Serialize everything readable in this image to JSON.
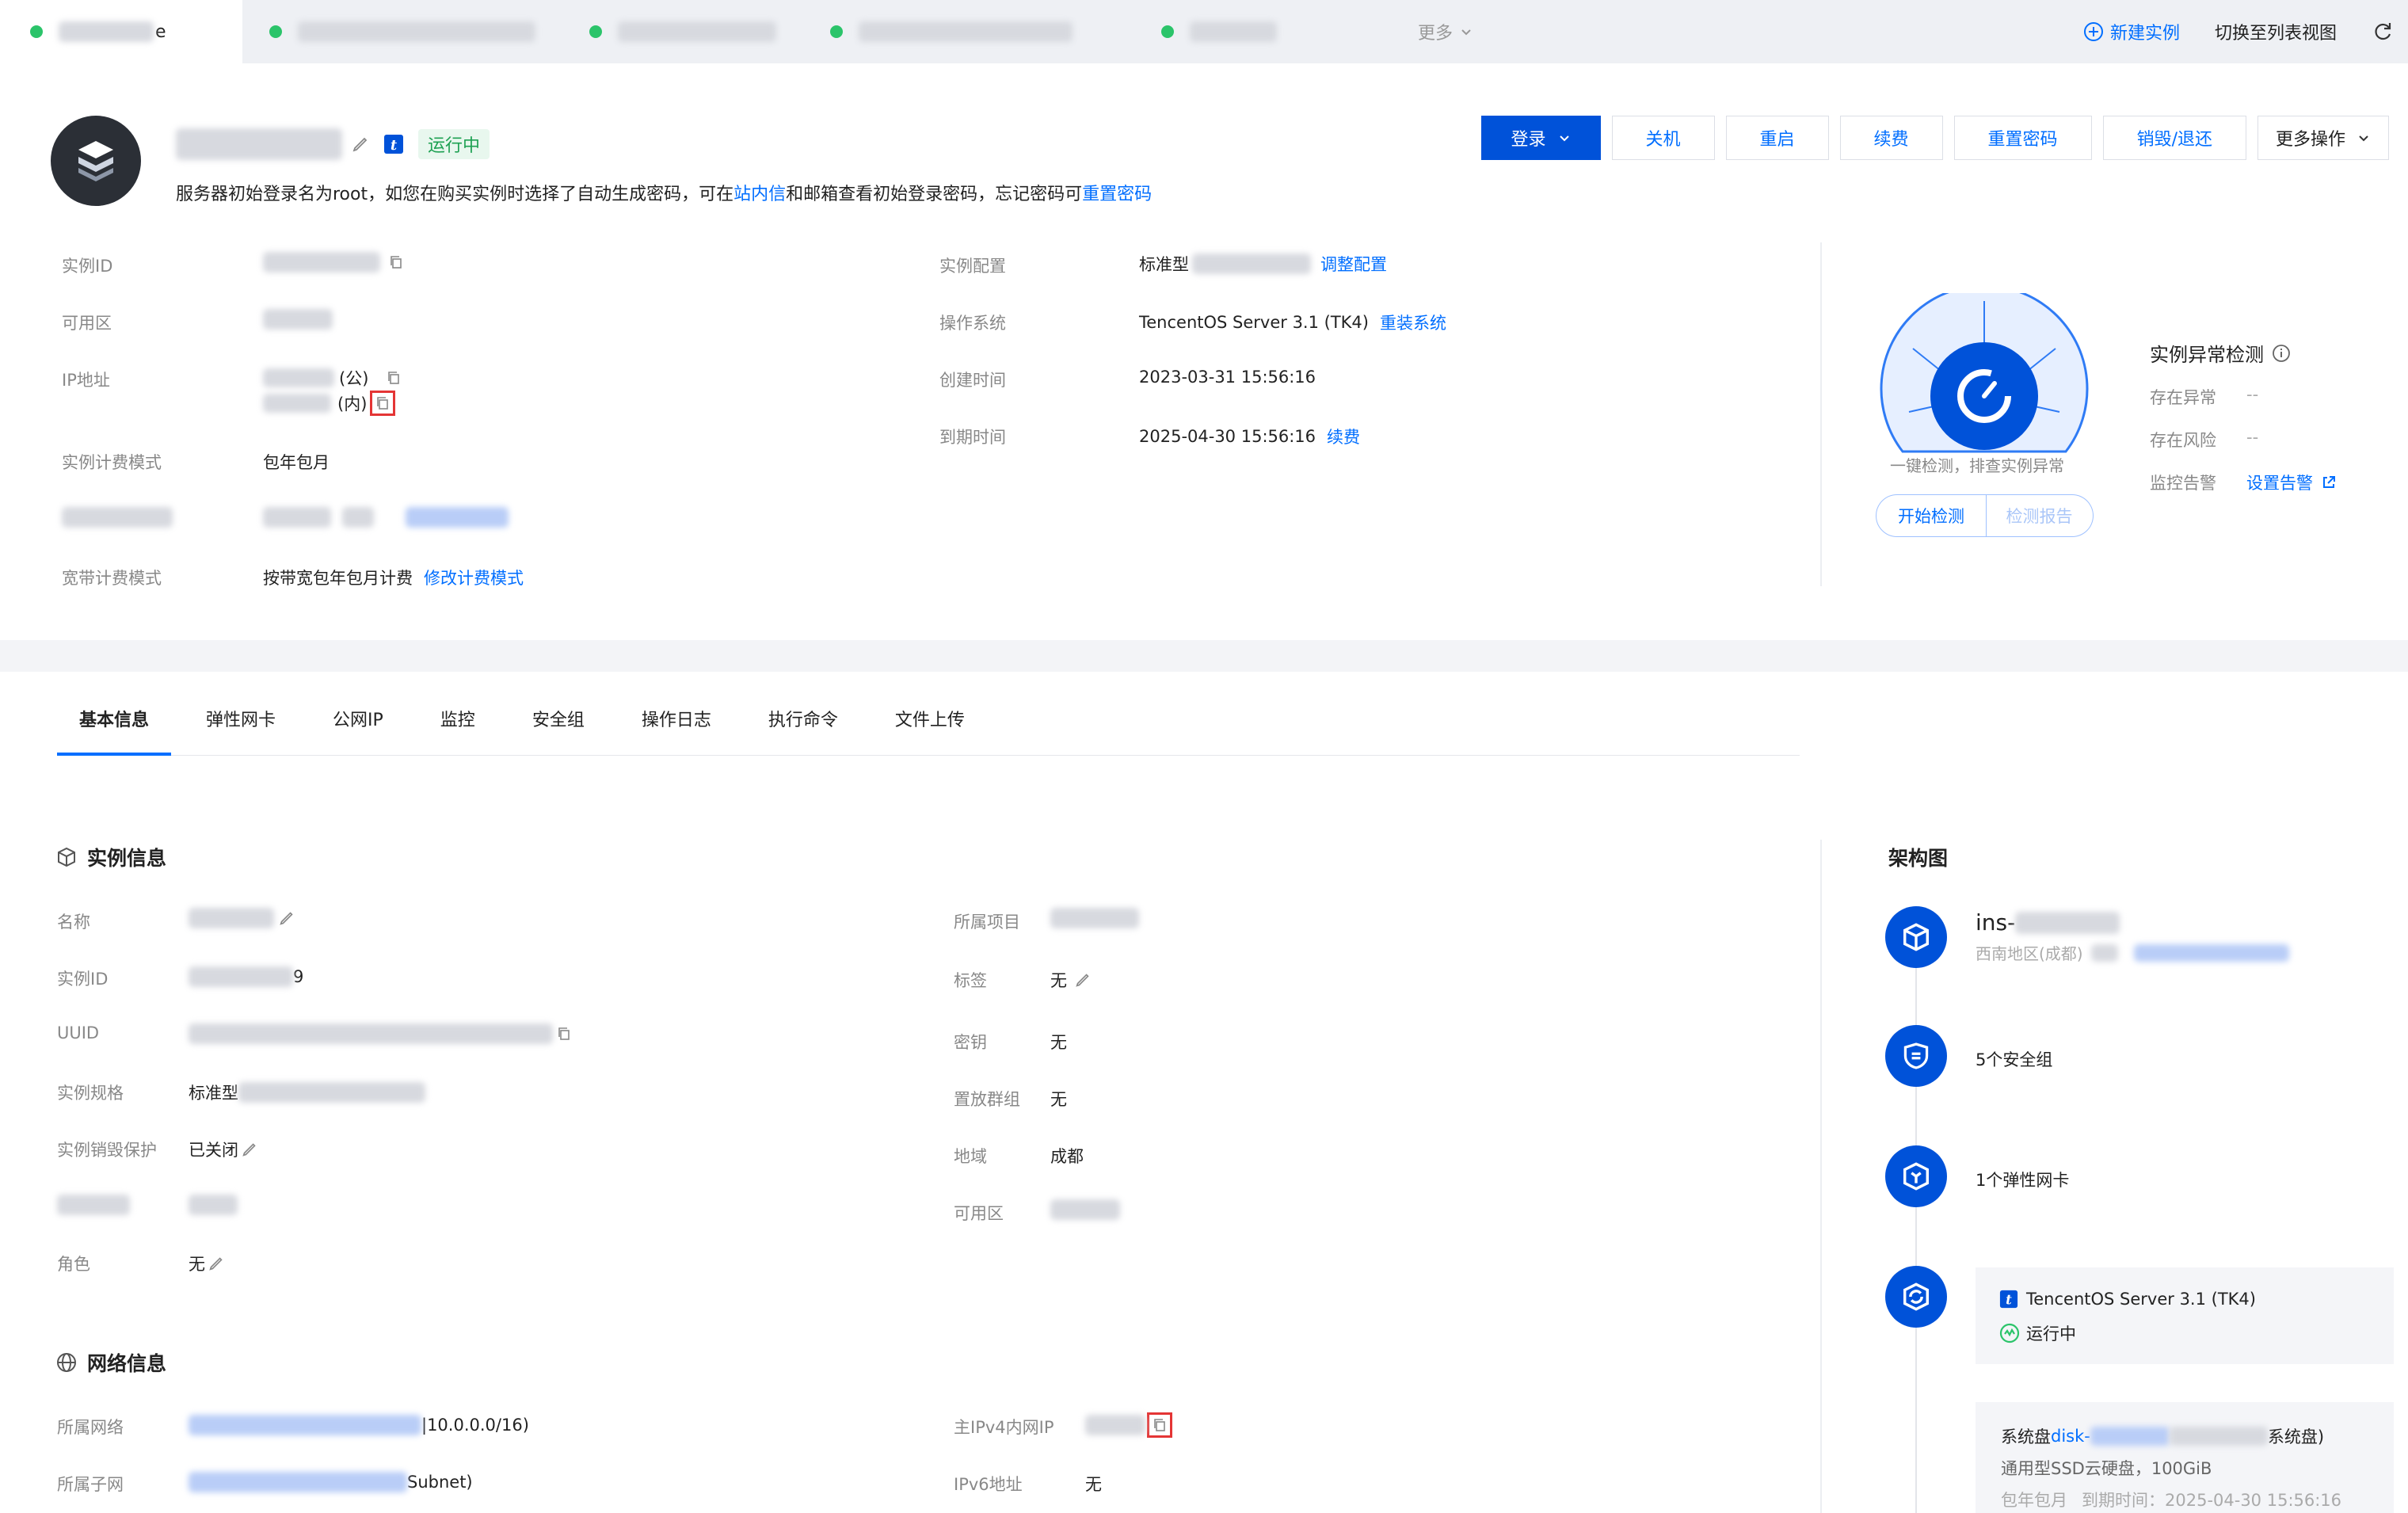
{
  "tabs": [
    {
      "label": "e",
      "active": true
    },
    {
      "label": "",
      "active": false
    },
    {
      "label": "",
      "active": false
    },
    {
      "label": "",
      "active": false
    },
    {
      "label": "",
      "active": false
    }
  ],
  "tab_more": "更多",
  "top_right": {
    "new_instance": "新建实例",
    "switch_list": "切换至列表视图"
  },
  "header": {
    "status": "运行中",
    "notice_prefix": "服务器初始登录名为root，如您在购买实例时选择了自动生成密码，可在",
    "notice_link1": "站内信",
    "notice_mid": "和邮箱查看初始登录密码，忘记密码可",
    "notice_link2": "重置密码"
  },
  "actions": {
    "login": "登录",
    "shutdown": "关机",
    "restart": "重启",
    "renew": "续费",
    "reset_pwd": "重置密码",
    "destroy": "销毁/退还",
    "more": "更多操作"
  },
  "summary": {
    "instance_id_label": "实例ID",
    "zone_label": "可用区",
    "ip_label": "IP地址",
    "ip_public": "(公)",
    "ip_private": "(内)",
    "billing_label": "实例计费模式",
    "billing_value": "包年包月",
    "bandwidth_label": "宽带计费模式",
    "bandwidth_value": "按带宽包年包月计费",
    "bandwidth_link": "修改计费模式",
    "config_label": "实例配置",
    "config_value": "标准型",
    "config_link": "调整配置",
    "os_label": "操作系统",
    "os_value": "TencentOS Server 3.1 (TK4)",
    "os_link": "重装系统",
    "created_label": "创建时间",
    "created_value": "2023-03-31 15:56:16",
    "expire_label": "到期时间",
    "expire_value": "2025-04-30 15:56:16",
    "expire_link": "续费"
  },
  "detect": {
    "caption": "一键检测，排查实例异常",
    "start": "开始检测",
    "report": "检测报告",
    "title": "实例异常检测",
    "abnormal_label": "存在异常",
    "abnormal_value": "--",
    "risk_label": "存在风险",
    "risk_value": "--",
    "alarm_label": "监控告警",
    "alarm_link": "设置告警"
  },
  "subtabs": [
    "基本信息",
    "弹性网卡",
    "公网IP",
    "监控",
    "安全组",
    "操作日志",
    "执行命令",
    "文件上传"
  ],
  "instance_info": {
    "title": "实例信息",
    "name_label": "名称",
    "id_label": "实例ID",
    "id_suffix": "9",
    "uuid_label": "UUID",
    "spec_label": "实例规格",
    "spec_value": "标准型",
    "protect_label": "实例销毁保护",
    "protect_value": "已关闭",
    "role_label": "角色",
    "role_value": "无",
    "project_label": "所属项目",
    "tag_label": "标签",
    "tag_value": "无",
    "key_label": "密钥",
    "key_value": "无",
    "placement_label": "置放群组",
    "placement_value": "无",
    "region_label": "地域",
    "region_value": "成都",
    "zone_label": "可用区"
  },
  "network_info": {
    "title": "网络信息",
    "vpc_label": "所属网络",
    "vpc_suffix": "|10.0.0.0/16)",
    "subnet_label": "所属子网",
    "subnet_suffix": "Subnet)",
    "ipv4_label": "主IPv4内网IP",
    "ipv6_label": "IPv6地址",
    "ipv6_value": "无"
  },
  "arch": {
    "title": "架构图",
    "ins_prefix": "ins-",
    "region": "西南地区(成都)",
    "security_groups": "5个安全组",
    "enis": "1个弹性网卡",
    "os": "TencentOS Server 3.1 (TK4)",
    "os_status": "运行中",
    "disk_prefix": "系统盘",
    "disk_link": "disk-",
    "disk_suffix": "系统盘)",
    "disk_type": "通用型SSD云硬盘，100GiB",
    "disk_billing": "包年包月",
    "disk_expire": "到期时间：2025-04-30 15:56:16"
  },
  "colors": {
    "primary": "#0052d9",
    "link": "#006eff",
    "running": "#2bc46a"
  }
}
